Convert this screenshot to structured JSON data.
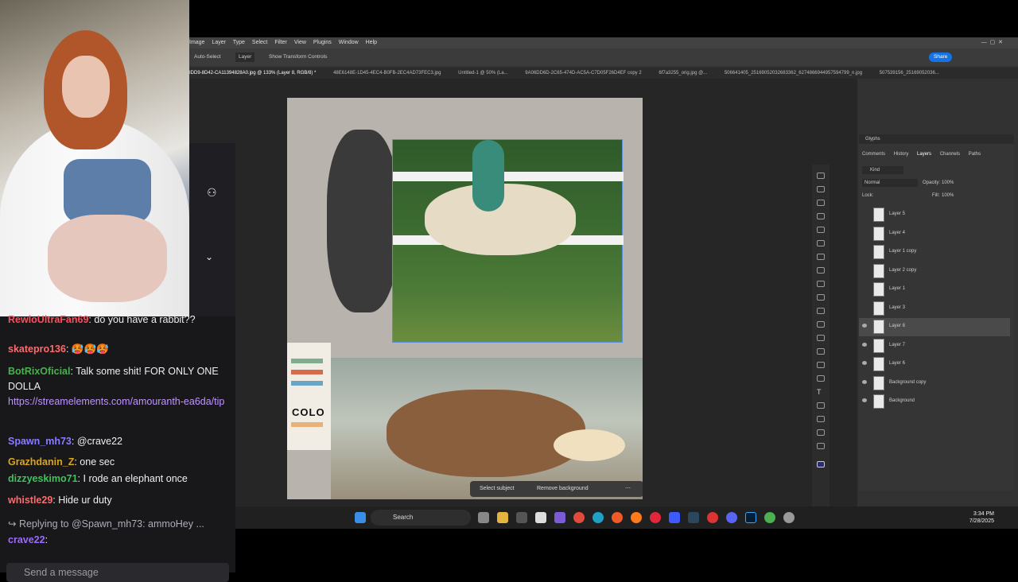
{
  "photoshop": {
    "menu": [
      "Image",
      "Layer",
      "Type",
      "Select",
      "Filter",
      "View",
      "Plugins",
      "Window",
      "Help"
    ],
    "options": {
      "auto_select": "Auto-Select",
      "layer_select": "Layer",
      "show_transform": "Show Transform Controls",
      "share": "Share"
    },
    "tabs": [
      "IDD9-8D42-CA11394828A0.jpg @ 133% (Layer 8, RGB/8) *",
      "48E6148E-1D45-4EC4-B0FB-2EC4AD73FEC3.jpg",
      "Untitled-1 @ 50% (La...",
      "9A06DD6D-2C65-474D-AC5A-C7D05F26D4EF copy 2",
      "6f7a3255_orig.jpg @...",
      "506641405_2516905203268336​2_6274866944957594799_n.jpg",
      "507539156_25169052036..."
    ],
    "canvas_text": "COLO",
    "context_bar": {
      "select_subject": "Select subject",
      "remove_background": "Remove background"
    },
    "panel": {
      "title": "Glyphs",
      "tabs": [
        "Comments",
        "History",
        "Layers",
        "Channels",
        "Paths"
      ],
      "filter": "Kind",
      "blend": "Normal",
      "opacity_label": "Opacity:",
      "opacity": "100%",
      "lock_label": "Lock:",
      "fill_label": "Fill:",
      "fill": "100%",
      "layers": [
        {
          "name": "Layer 5",
          "visible": false
        },
        {
          "name": "Layer 4",
          "visible": false
        },
        {
          "name": "Layer 1 copy",
          "visible": false
        },
        {
          "name": "Layer 2 copy",
          "visible": false
        },
        {
          "name": "Layer 1",
          "visible": false
        },
        {
          "name": "Layer 3",
          "visible": false
        },
        {
          "name": "Layer 8",
          "visible": true
        },
        {
          "name": "Layer 7",
          "visible": true
        },
        {
          "name": "Layer 6",
          "visible": true
        },
        {
          "name": "Background copy",
          "visible": true
        },
        {
          "name": "Background",
          "visible": true
        }
      ]
    }
  },
  "chat": {
    "messages": [
      {
        "user": "RewloUltraFan69",
        "text": ": do you have a rabbit??",
        "color": "#ff4d5a"
      },
      {
        "user": "skatepro136",
        "text": ": 🥵🥵🥵",
        "color": "#ff6b6b"
      },
      {
        "user": "BotRixOficial",
        "text": ": Talk some shit! FOR ONLY ONE DOLLA",
        "color": "#4caf50",
        "link": "https://streamelements.com/amouranth-ea6da/tip"
      },
      {
        "user": "Spawn_mh73",
        "text": ": @crave22",
        "color": "#8a7cff"
      },
      {
        "user": "Grazhdanin_Z",
        "text": ": one sec",
        "color": "#daa520"
      },
      {
        "user": "dizzyeskimo71",
        "text": ": I rode an elephant once",
        "color": "#3fc35a"
      },
      {
        "user": "whistle29",
        "text": ": Hide ur duty",
        "color": "#ff6b6b"
      },
      {
        "user": "crave22",
        "text": ":",
        "color": "#9b6bff"
      }
    ],
    "reply_label": "Replying to @Spawn_mh73: ammoHey ...",
    "input_placeholder": "Send a message"
  },
  "taskbar": {
    "search": "Search",
    "time": "3:34 PM",
    "date": "7/28/2025"
  },
  "colors": {
    "ps_bg": "#323232",
    "chat_bg": "#18181b",
    "accent": "#1473e6"
  }
}
